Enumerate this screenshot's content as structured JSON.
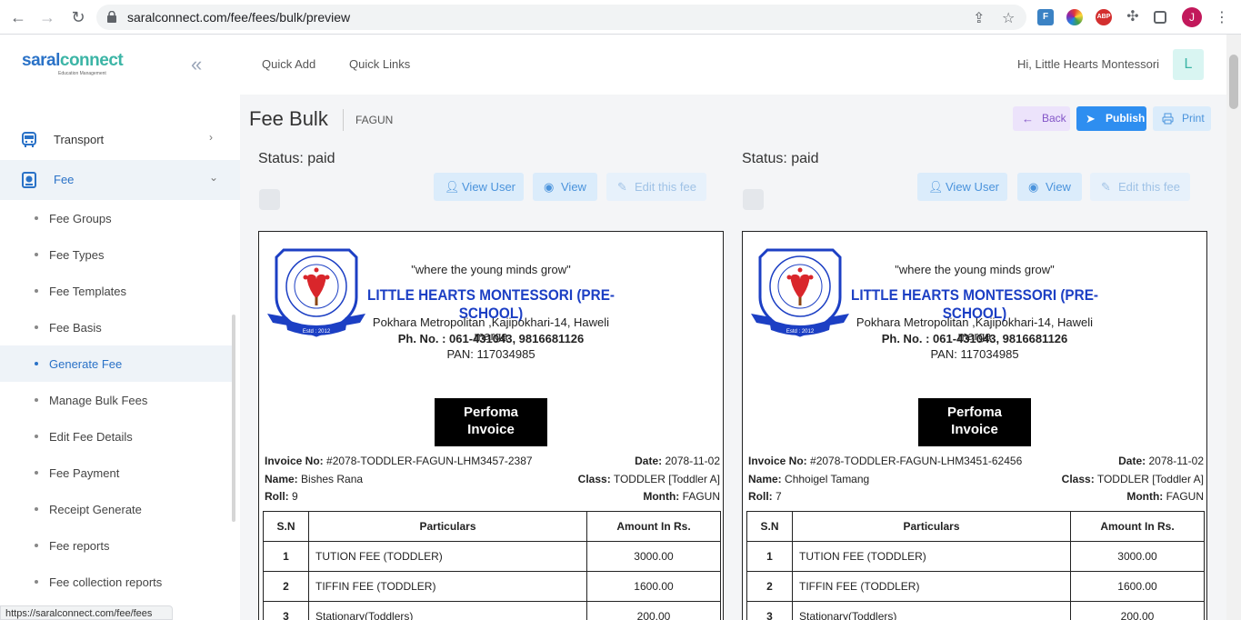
{
  "browser": {
    "url": "saralconnect.com/fee/fees/bulk/preview",
    "profile_initial": "J",
    "ext_abp": "ABP",
    "status_url": "https://saralconnect.com/fee/fees"
  },
  "sidebar": {
    "logo_main_a": "saral",
    "logo_main_b": "connect",
    "logo_sub": "Education Management",
    "menu": [
      {
        "label": "Transport"
      },
      {
        "label": "Fee"
      }
    ],
    "sub_items": [
      {
        "label": "Fee Groups"
      },
      {
        "label": "Fee Types"
      },
      {
        "label": "Fee Templates"
      },
      {
        "label": "Fee Basis"
      },
      {
        "label": "Generate Fee"
      },
      {
        "label": "Manage Bulk Fees"
      },
      {
        "label": "Edit Fee Details"
      },
      {
        "label": "Fee Payment"
      },
      {
        "label": "Receipt Generate"
      },
      {
        "label": "Fee reports"
      },
      {
        "label": "Fee collection reports"
      }
    ],
    "active_item": "Generate Fee"
  },
  "topbar": {
    "quick_add": "Quick Add",
    "quick_links": "Quick Links",
    "greeting": "Hi, Little Hearts Montessori",
    "avatar_initial": "L"
  },
  "page": {
    "title": "Fee Bulk",
    "subtitle": "FAGUN",
    "back": "Back",
    "publish": "Publish",
    "print": "Print"
  },
  "actions": {
    "view_user": "View User",
    "view": "View",
    "edit": "Edit this fee"
  },
  "school": {
    "motto": "\"where the young minds grow\"",
    "name": "LITTLE HEARTS MONTESSORI (PRE-SCHOOL)",
    "address": "Pokhara Metropolitan ,Kajipokhari-14, Haweli marga",
    "phone": "Ph. No. : 061-431043, 9816681126",
    "pan": "PAN: 117034985",
    "seal_text": "Estd : 2012",
    "seal_ring": "Little Hearts Montessori · where the young minds grow"
  },
  "invoice_badge": [
    "Perfoma",
    "Invoice"
  ],
  "labels": {
    "invoice_no": "Invoice No:",
    "date": "Date:",
    "name": "Name:",
    "class": "Class:",
    "roll": "Roll:",
    "month": "Month:"
  },
  "table_headers": [
    "S.N",
    "Particulars",
    "Amount In Rs."
  ],
  "invoices": [
    {
      "status": "Status: paid",
      "invoice_no": "#2078-TODDLER-FAGUN-LHM3457-2387",
      "date": "2078-11-02",
      "name": "Bishes Rana",
      "class": "TODDLER [Toddler A]",
      "roll": "9",
      "month": "FAGUN",
      "rows": [
        {
          "sn": "1",
          "particular": "TUTION FEE (TODDLER)",
          "amount": "3000.00"
        },
        {
          "sn": "2",
          "particular": "TIFFIN FEE (TODDLER)",
          "amount": "1600.00"
        },
        {
          "sn": "3",
          "particular": "Stationary(Toddlers)",
          "amount": "200.00"
        }
      ]
    },
    {
      "status": "Status: paid",
      "invoice_no": "#2078-TODDLER-FAGUN-LHM3451-62456",
      "date": "2078-11-02",
      "name": "Chhoigel Tamang",
      "class": "TODDLER [Toddler A]",
      "roll": "7",
      "month": "FAGUN",
      "rows": [
        {
          "sn": "1",
          "particular": "TUTION FEE (TODDLER)",
          "amount": "3000.00"
        },
        {
          "sn": "2",
          "particular": "TIFFIN FEE (TODDLER)",
          "amount": "1600.00"
        },
        {
          "sn": "3",
          "particular": "Stationary(Toddlers)",
          "amount": "200.00"
        }
      ]
    }
  ]
}
